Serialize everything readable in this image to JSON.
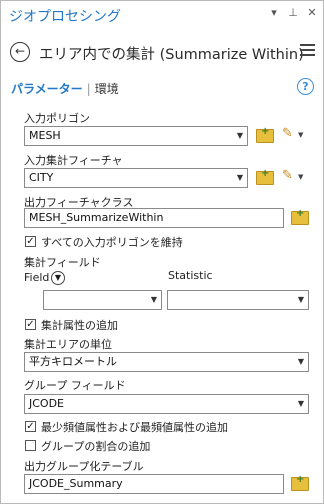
{
  "pane": {
    "title": "ジオプロセシング",
    "icons": [
      "chevron-down-icon",
      "pin-icon",
      "close-icon"
    ]
  },
  "tool": {
    "title": "エリア内での集計 (Summarize Within)",
    "back_icon": "back-arrow-icon",
    "menu_icon": "hamburger-menu-icon"
  },
  "tabs": {
    "parameters": "パラメーター",
    "separator": "|",
    "environment": "環境",
    "help_icon": "?"
  },
  "params": {
    "input_polygons": {
      "label": "入力ポリゴン",
      "value": "MESH"
    },
    "input_summary": {
      "label": "入力集計フィーチャ",
      "value": "CITY"
    },
    "output_fc": {
      "label": "出力フィーチャクラス",
      "value": "MESH_SummarizeWithin"
    },
    "keep_all": {
      "label": "すべての入力ポリゴンを維持",
      "checked": true
    },
    "summary_fields": {
      "label": "集計フィールド",
      "field_col": "Field",
      "stat_col": "Statistic",
      "field_value": "",
      "stat_value": ""
    },
    "add_shape": {
      "label": "集計属性の追加",
      "checked": true
    },
    "area_unit": {
      "label": "集計エリアの単位",
      "value": "平方キロメートル"
    },
    "group_field": {
      "label": "グループ フィールド",
      "value": "JCODE"
    },
    "add_minmax": {
      "label": "最少頻値属性および最頻値属性の追加",
      "checked": true
    },
    "add_pct": {
      "label": "グループの割合の追加",
      "checked": false
    },
    "out_group_table": {
      "label": "出力グループ化テーブル",
      "value": "JCODE_Summary"
    }
  },
  "colors": {
    "accent": "#2278c8",
    "folder": "#e8bf3c",
    "pencil": "#c98a1c"
  }
}
